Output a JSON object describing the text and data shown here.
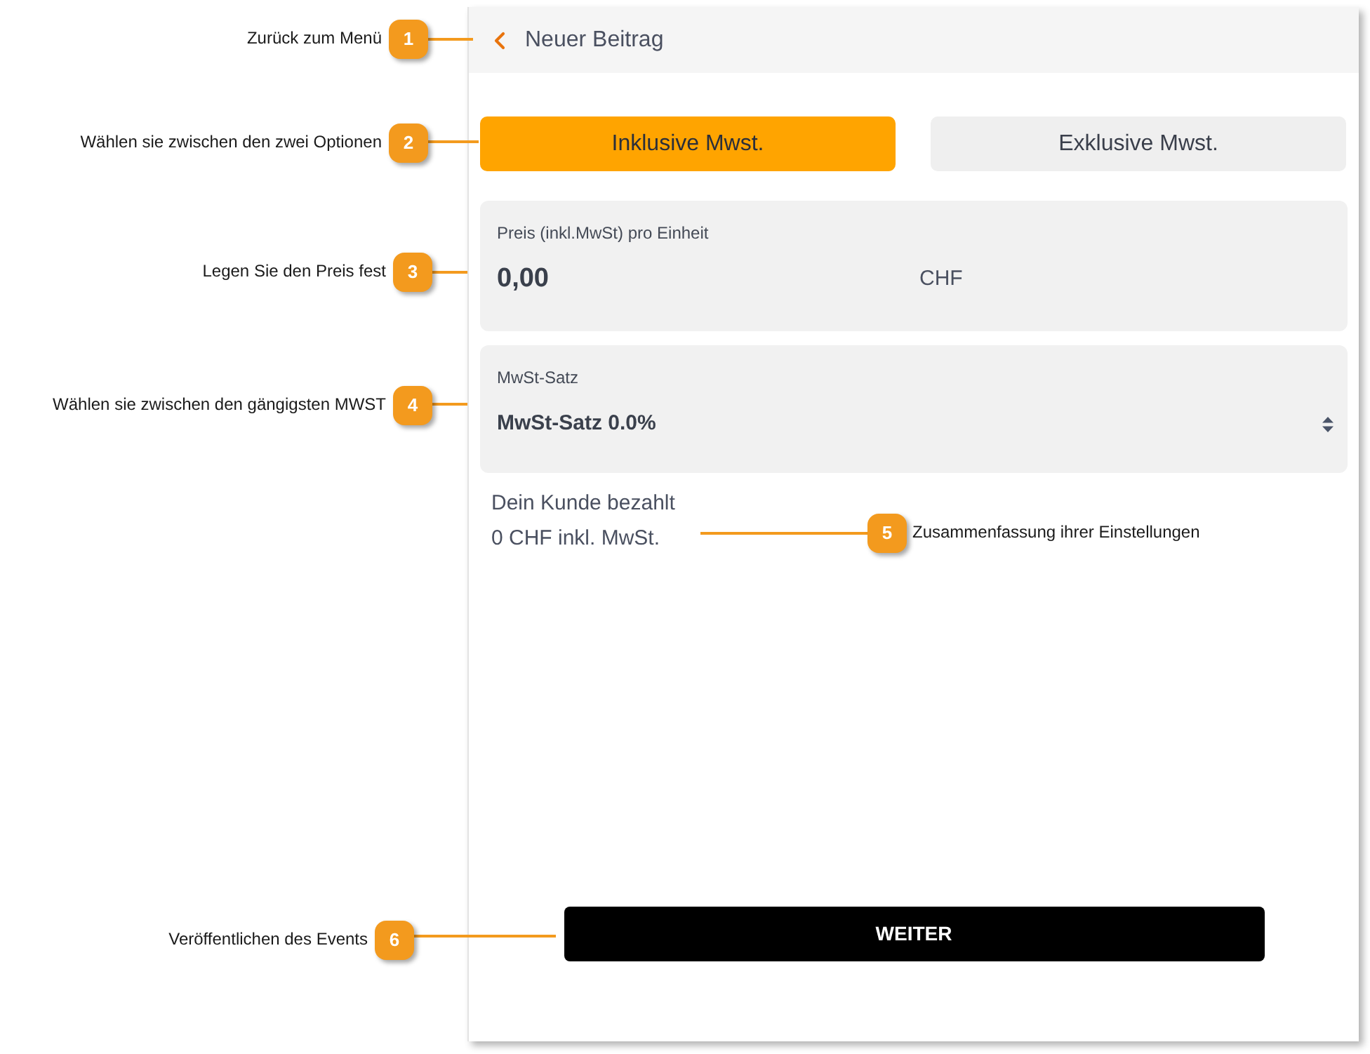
{
  "annotations": [
    {
      "number": "1",
      "text": "Zurück zum Menü"
    },
    {
      "number": "2",
      "text": "Wählen sie zwischen den zwei Optionen"
    },
    {
      "number": "3",
      "text": "Legen Sie den Preis fest"
    },
    {
      "number": "4",
      "text": "Wählen sie zwischen den gängigsten MWST"
    },
    {
      "number": "5",
      "text": "Zusammenfassung ihrer Einstellungen"
    },
    {
      "number": "6",
      "text": "Veröffentlichen des Events"
    }
  ],
  "screen": {
    "header": {
      "title": "Neuer Beitrag"
    },
    "vat_mode_options": [
      {
        "label": "Inklusive Mwst.",
        "selected": true
      },
      {
        "label": "Exklusive Mwst.",
        "selected": false
      }
    ],
    "price_field": {
      "label": "Preis (inkl.MwSt) pro Einheit",
      "value": "0,00",
      "currency": "CHF"
    },
    "vat_rate_select": {
      "label": "MwSt-Satz",
      "value": "MwSt-Satz 0.0%"
    },
    "summary": {
      "lines": [
        "Dein Kunde bezahlt",
        "0 CHF inkl. MwSt."
      ]
    },
    "submit_button": {
      "label": "WEITER"
    }
  }
}
